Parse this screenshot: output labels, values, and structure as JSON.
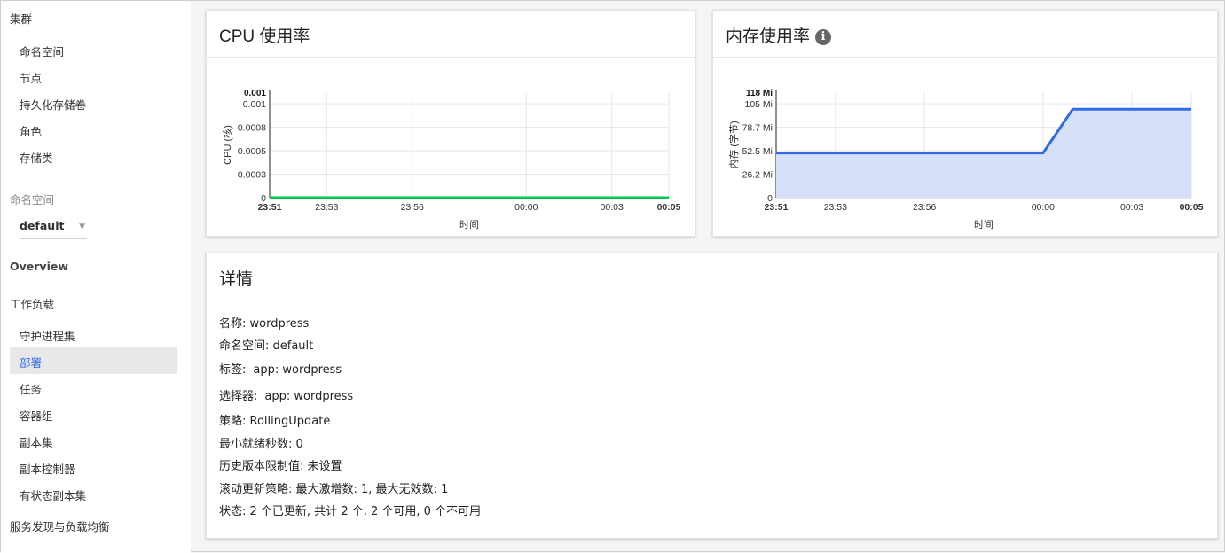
{
  "sidebar": {
    "cluster_header": "集群",
    "cluster_items": [
      "命名空间",
      "节点",
      "持久化存储卷",
      "角色",
      "存储类"
    ],
    "namespace_header": "命名空间",
    "namespace_value": "default",
    "overview": "Overview",
    "workloads_header": "工作负载",
    "workload_items": [
      "守护进程集",
      "部署",
      "任务",
      "容器组",
      "副本集",
      "副本控制器",
      "有状态副本集"
    ],
    "active_item": "部署",
    "discovery_header": "服务发现与负载均衡"
  },
  "cpu_card": {
    "title": "CPU 使用率"
  },
  "mem_card": {
    "title": "内存使用率",
    "info_icon": "info-icon"
  },
  "details_card": {
    "title": "详情",
    "rows": {
      "name": "名称: wordpress",
      "namespace": "命名空间: default",
      "labels_key": "标签:",
      "labels_value": "app: wordpress",
      "selector_key": "选择器:",
      "selector_value": "app: wordpress",
      "strategy": "策略: RollingUpdate",
      "min_ready": "最小就绪秒数: 0",
      "revision_limit": "历史版本限制值: 未设置",
      "rolling_update": "滚动更新策略: 最大激增数: 1, 最大无效数: 1",
      "status": "状态: 2 个已更新, 共计 2 个, 2 个可用, 0 个不可用"
    }
  },
  "chart_data": [
    {
      "type": "line",
      "title": "CPU 使用率",
      "xlabel": "时间",
      "ylabel": "CPU (核)",
      "x": [
        "23:51",
        "23:53",
        "23:56",
        "00:00",
        "00:03",
        "00:05"
      ],
      "x_bold": [
        "23:51",
        "00:05"
      ],
      "yticks": [
        "0",
        "0.0003",
        "0.0005",
        "0.0008",
        "0.001"
      ],
      "ymax_label": "0.001",
      "ylim": [
        0,
        0.00105
      ],
      "series": [
        {
          "values": [
            0,
            0,
            0,
            0,
            0,
            0
          ],
          "color": "#00c752"
        }
      ],
      "grid": true
    },
    {
      "type": "area",
      "title": "内存使用率",
      "xlabel": "时间",
      "ylabel": "内存 (字节)",
      "x": [
        "23:51",
        "23:53",
        "23:56",
        "00:00",
        "00:03",
        "00:05"
      ],
      "x_bold": [
        "23:51",
        "00:05"
      ],
      "yticks": [
        "0",
        "26.2 Mi",
        "52.5 Mi",
        "78.7 Mi",
        "105 Mi"
      ],
      "ymax_label": "118 Mi",
      "ylim": [
        0,
        118
      ],
      "series": [
        {
          "points": [
            [
              "23:51",
              50
            ],
            [
              "00:00",
              50
            ],
            [
              "00:01",
              99
            ],
            [
              "00:05",
              99
            ]
          ],
          "color": "#326ce5",
          "fill": "#d6e0f9"
        }
      ],
      "grid": true
    }
  ]
}
